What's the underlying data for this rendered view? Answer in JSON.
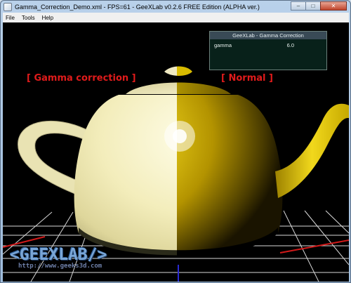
{
  "window": {
    "title": "Gamma_Correction_Demo.xml - FPS=61 - GeeXLab v0.2.6 FREE Edition (ALPHA ver.)",
    "controls": {
      "minimize": "–",
      "maximize": "□",
      "close": "✕"
    }
  },
  "menu": {
    "items": [
      "File",
      "Tools",
      "Help"
    ]
  },
  "scene": {
    "left_label": "[ Gamma correction ]",
    "right_label": "[ Normal ]"
  },
  "panel": {
    "title": "GeeXLab - Gamma Correction",
    "param_name": "gamma",
    "param_value": "6.0"
  },
  "logo": {
    "main": "<GEEXLAB/>",
    "url": "http://www.geeks3d.com"
  },
  "colors": {
    "label_red": "#e01b1b",
    "left_teapot": "#f5f0bf",
    "right_teapot": "#d9c100",
    "grid_red": "#d21a1a",
    "grid_blue": "#2a2ad4"
  }
}
